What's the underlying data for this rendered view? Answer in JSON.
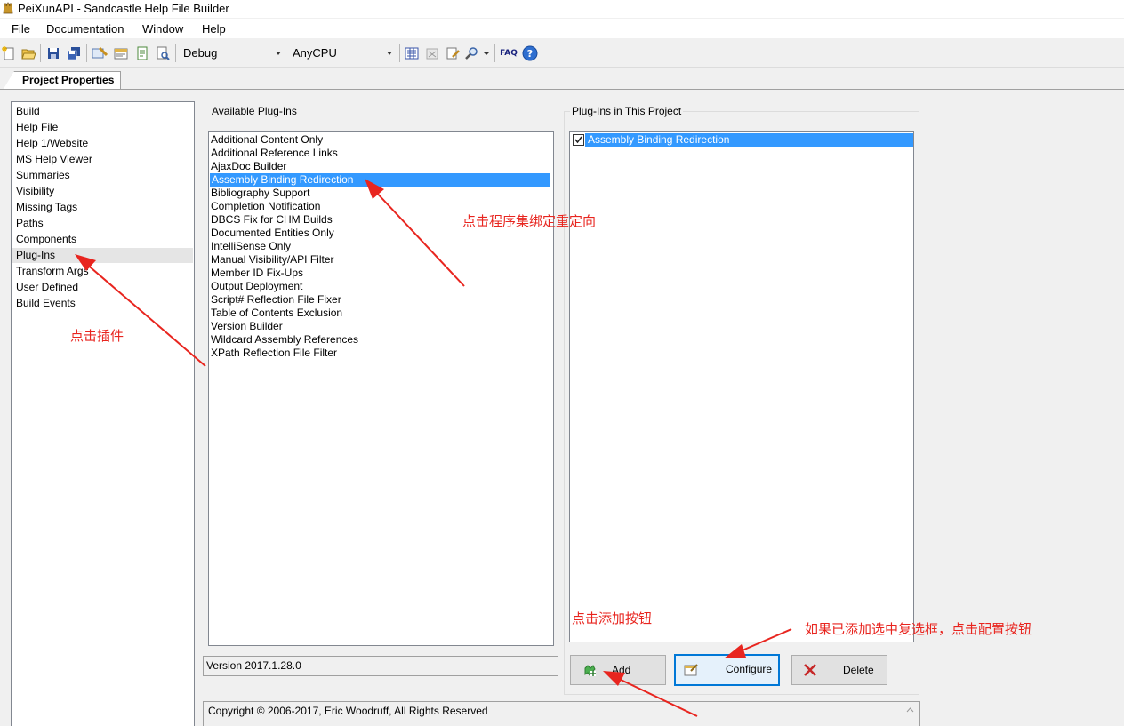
{
  "window": {
    "title": "PeiXunAPI - Sandcastle Help File Builder"
  },
  "menu": {
    "items": [
      "File",
      "Documentation",
      "Window",
      "Help"
    ]
  },
  "toolbar": {
    "config": "Debug",
    "platform": "AnyCPU",
    "faq": "FAQ"
  },
  "tabs": {
    "project_properties": "Project Properties"
  },
  "nav": {
    "items": [
      "Build",
      "Help File",
      "Help 1/Website",
      "MS Help Viewer",
      "Summaries",
      "Visibility",
      "Missing Tags",
      "Paths",
      "Components",
      "Plug-Ins",
      "Transform Args",
      "User Defined",
      "Build Events"
    ],
    "selected": "Plug-Ins"
  },
  "available": {
    "title": "Available Plug-Ins",
    "items": [
      "Additional Content Only",
      "Additional Reference Links",
      "AjaxDoc Builder",
      "Assembly Binding Redirection",
      "Bibliography Support",
      "Completion Notification",
      "DBCS Fix for CHM Builds",
      "Documented Entities Only",
      "IntelliSense Only",
      "Manual Visibility/API Filter",
      "Member ID Fix-Ups",
      "Output Deployment",
      "Script# Reflection File Fixer",
      "Table of Contents Exclusion",
      "Version Builder",
      "Wildcard Assembly References",
      "XPath Reflection File Filter"
    ],
    "selected": "Assembly Binding Redirection",
    "version": "Version 2017.1.28.0"
  },
  "project": {
    "title": "Plug-Ins in This Project",
    "items": [
      {
        "label": "Assembly Binding Redirection",
        "checked": true
      }
    ]
  },
  "buttons": {
    "add": "Add",
    "configure": "Configure",
    "delete": "Delete"
  },
  "copyright": "Copyright © 2006-2017, Eric Woodruff, All Rights Reserved",
  "annotations": {
    "click_plugins": "点击插件",
    "click_assembly": "点击程序集绑定重定向",
    "click_add": "点击添加按钮",
    "click_configure": "如果已添加选中复选框，点击配置按钮"
  },
  "colors": {
    "selection": "#3399ff",
    "annotation": "#e8251f",
    "default_button_border": "#0078d7"
  }
}
